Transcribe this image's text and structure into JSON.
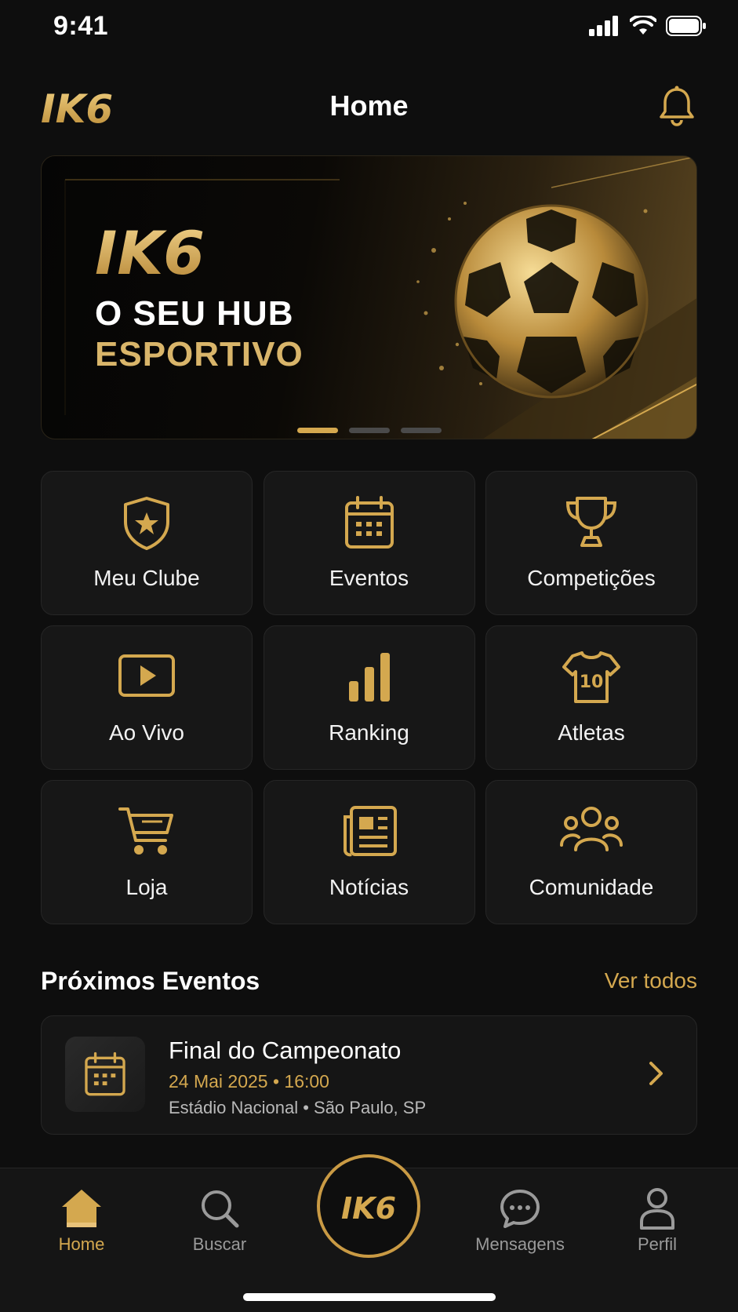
{
  "status_bar": {
    "time": "9:41"
  },
  "header": {
    "logo": "IK6",
    "title": "Home"
  },
  "banner": {
    "brand": "IK6",
    "line1": "O SEU HUB",
    "line2": "ESPORTIVO",
    "slide_count": 3,
    "active_slide": 1
  },
  "menu": [
    {
      "label": "Meu Clube",
      "icon": "shield-star-icon"
    },
    {
      "label": "Eventos",
      "icon": "calendar-icon"
    },
    {
      "label": "Competições",
      "icon": "trophy-icon"
    },
    {
      "label": "Ao Vivo",
      "icon": "play-icon"
    },
    {
      "label": "Ranking",
      "icon": "bar-chart-icon"
    },
    {
      "label": "Atletas",
      "icon": "jersey-icon"
    },
    {
      "label": "Loja",
      "icon": "cart-icon"
    },
    {
      "label": "Notícias",
      "icon": "newspaper-icon"
    },
    {
      "label": "Comunidade",
      "icon": "community-icon"
    }
  ],
  "jersey_number": "10",
  "upcoming": {
    "title": "Próximos Eventos",
    "see_all": "Ver todos",
    "event": {
      "title": "Final do Campeonato",
      "date": "24 Mai 2025 • 16:00",
      "venue": "Estádio Nacional • São Paulo, SP"
    }
  },
  "bottom_nav": {
    "home": "Home",
    "search": "Buscar",
    "center_logo": "IK6",
    "messages": "Mensagens",
    "profile": "Perfil"
  },
  "colors": {
    "accent": "#d4a84f",
    "background": "#0e0e0e",
    "tile": "#171717"
  }
}
